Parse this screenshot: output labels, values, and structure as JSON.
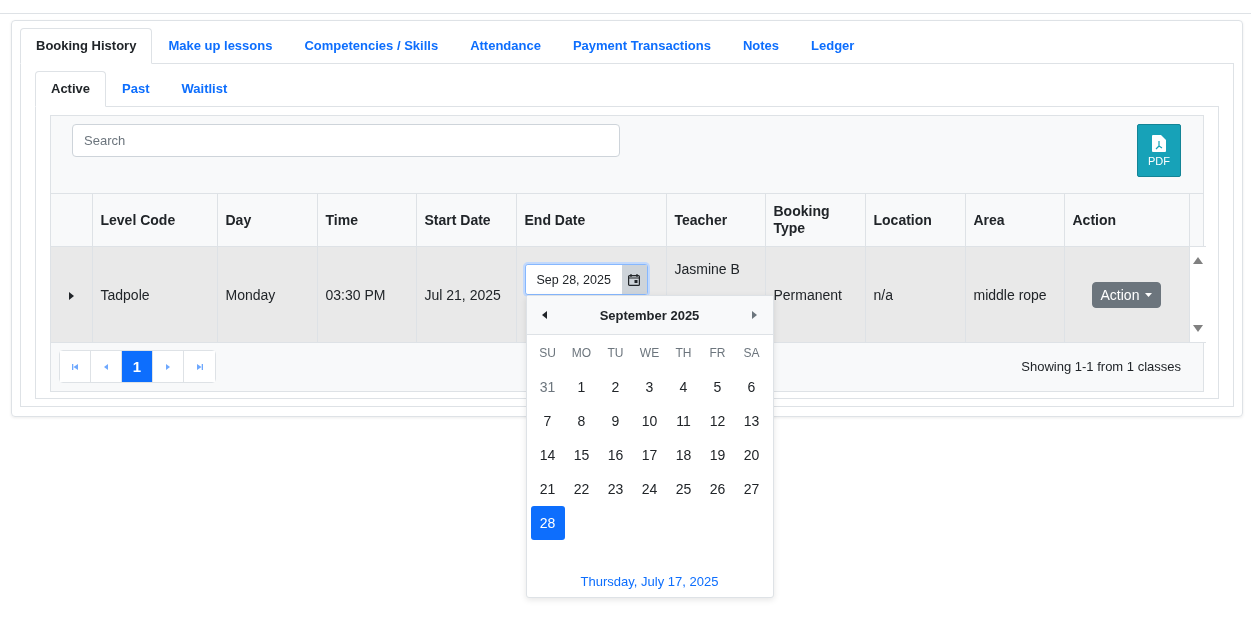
{
  "tabs": [
    {
      "label": "Booking History",
      "selected": true
    },
    {
      "label": "Make up lessons",
      "selected": false
    },
    {
      "label": "Competencies / Skills",
      "selected": false
    },
    {
      "label": "Attendance",
      "selected": false
    },
    {
      "label": "Payment Transactions",
      "selected": false
    },
    {
      "label": "Notes",
      "selected": false
    },
    {
      "label": "Ledger",
      "selected": false
    }
  ],
  "subtabs": [
    {
      "label": "Active",
      "selected": true
    },
    {
      "label": "Past",
      "selected": false
    },
    {
      "label": "Waitlist",
      "selected": false
    }
  ],
  "search": {
    "placeholder": "Search"
  },
  "export_button": {
    "label": "PDF"
  },
  "table": {
    "columns": [
      "Level Code",
      "Day",
      "Time",
      "Start Date",
      "End Date",
      "Teacher",
      "Booking Type",
      "Location",
      "Area",
      "Action"
    ],
    "rows": [
      {
        "expanded": false,
        "level_code": "Tadpole",
        "day": "Monday",
        "time": "03:30 PM",
        "start_date": "Jul 21, 2025",
        "end_date": "Sep 28, 2025",
        "teacher": "Jasmine B",
        "booking_type": "Permanent",
        "location": "n/a",
        "area": "middle rope",
        "action": "Action"
      }
    ]
  },
  "pagination": {
    "pages": [
      {
        "label": "1",
        "selected": true
      }
    ],
    "summary": "Showing 1-1 from 1 classes"
  },
  "datepicker": {
    "title": "September 2025",
    "weekdays": [
      "SU",
      "MO",
      "TU",
      "WE",
      "TH",
      "FR",
      "SA"
    ],
    "days": [
      {
        "label": "31",
        "outside": true,
        "selected": false
      },
      {
        "label": "1",
        "outside": false,
        "selected": false
      },
      {
        "label": "2",
        "outside": false,
        "selected": false
      },
      {
        "label": "3",
        "outside": false,
        "selected": false
      },
      {
        "label": "4",
        "outside": false,
        "selected": false
      },
      {
        "label": "5",
        "outside": false,
        "selected": false
      },
      {
        "label": "6",
        "outside": false,
        "selected": false
      },
      {
        "label": "7",
        "outside": false,
        "selected": false
      },
      {
        "label": "8",
        "outside": false,
        "selected": false
      },
      {
        "label": "9",
        "outside": false,
        "selected": false
      },
      {
        "label": "10",
        "outside": false,
        "selected": false
      },
      {
        "label": "11",
        "outside": false,
        "selected": false
      },
      {
        "label": "12",
        "outside": false,
        "selected": false
      },
      {
        "label": "13",
        "outside": false,
        "selected": false
      },
      {
        "label": "14",
        "outside": false,
        "selected": false
      },
      {
        "label": "15",
        "outside": false,
        "selected": false
      },
      {
        "label": "16",
        "outside": false,
        "selected": false
      },
      {
        "label": "17",
        "outside": false,
        "selected": false
      },
      {
        "label": "18",
        "outside": false,
        "selected": false
      },
      {
        "label": "19",
        "outside": false,
        "selected": false
      },
      {
        "label": "20",
        "outside": false,
        "selected": false
      },
      {
        "label": "21",
        "outside": false,
        "selected": false
      },
      {
        "label": "22",
        "outside": false,
        "selected": false
      },
      {
        "label": "23",
        "outside": false,
        "selected": false
      },
      {
        "label": "24",
        "outside": false,
        "selected": false
      },
      {
        "label": "25",
        "outside": false,
        "selected": false
      },
      {
        "label": "26",
        "outside": false,
        "selected": false
      },
      {
        "label": "27",
        "outside": false,
        "selected": false
      },
      {
        "label": "28",
        "outside": false,
        "selected": true
      }
    ],
    "today": "Thursday, July 17, 2025"
  }
}
